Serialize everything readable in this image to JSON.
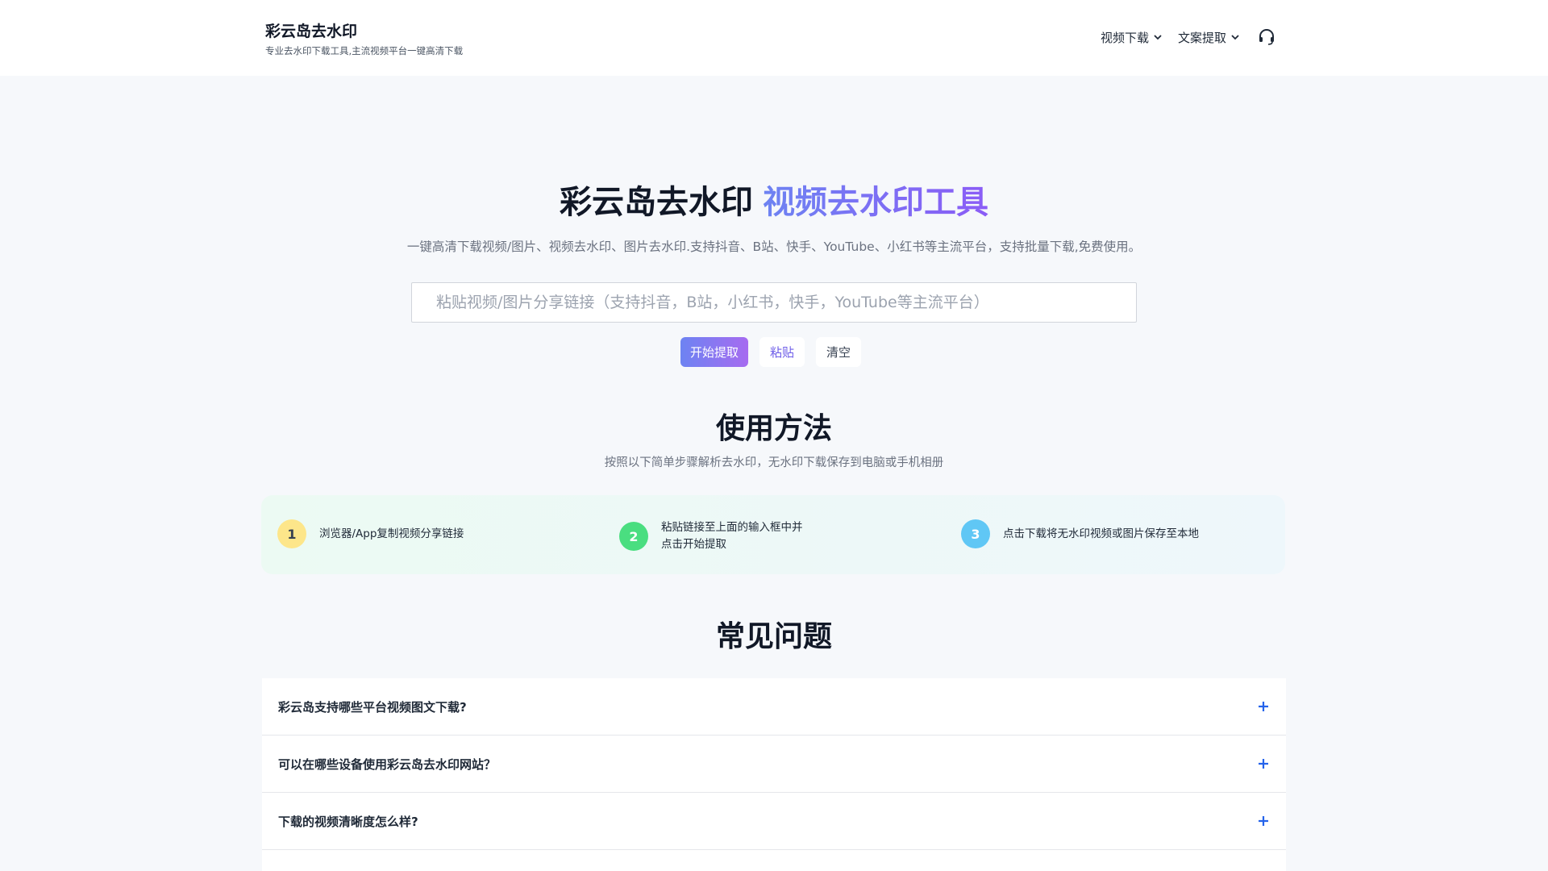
{
  "header": {
    "brand_title": "彩云岛去水印",
    "brand_subtitle": "专业去水印下载工具,主流视频平台一键高清下载",
    "nav": [
      {
        "label": "视频下载"
      },
      {
        "label": "文案提取"
      }
    ]
  },
  "hero": {
    "title_main": "彩云岛去水印",
    "title_accent": "视频去水印工具",
    "subtitle": "一键高清下载视频/图片、视频去水印、图片去水印.支持抖音、B站、快手、YouTube、小红书等主流平台，支持批量下载,免费使用。",
    "search_placeholder": "粘贴视频/图片分享链接（支持抖音，B站，小红书，快手，YouTube等主流平台）",
    "search_value": "",
    "buttons": {
      "start": "开始提取",
      "paste": "粘贴",
      "clear": "清空"
    }
  },
  "usage": {
    "title": "使用方法",
    "subtitle": "按照以下简单步骤解析去水印，无水印下载保存到电脑或手机相册",
    "steps": [
      {
        "num": "1",
        "text": "浏览器/App复制视频分享链接"
      },
      {
        "num": "2",
        "text_line1": "粘贴链接至上面的输入框中并",
        "text_line2": "点击开始提取"
      },
      {
        "num": "3",
        "text": "点击下载将无水印视频或图片保存至本地"
      }
    ]
  },
  "faq": {
    "title": "常见问题",
    "items": [
      {
        "question": "彩云岛支持哪些平台视频图文下载?"
      },
      {
        "question": "可以在哪些设备使用彩云岛去水印网站？"
      },
      {
        "question": "下载的视频清晰度怎么样?"
      }
    ]
  },
  "colors": {
    "accent_start": "#6d83f2",
    "accent_end": "#8b5cf6",
    "plus": "#2563eb"
  }
}
